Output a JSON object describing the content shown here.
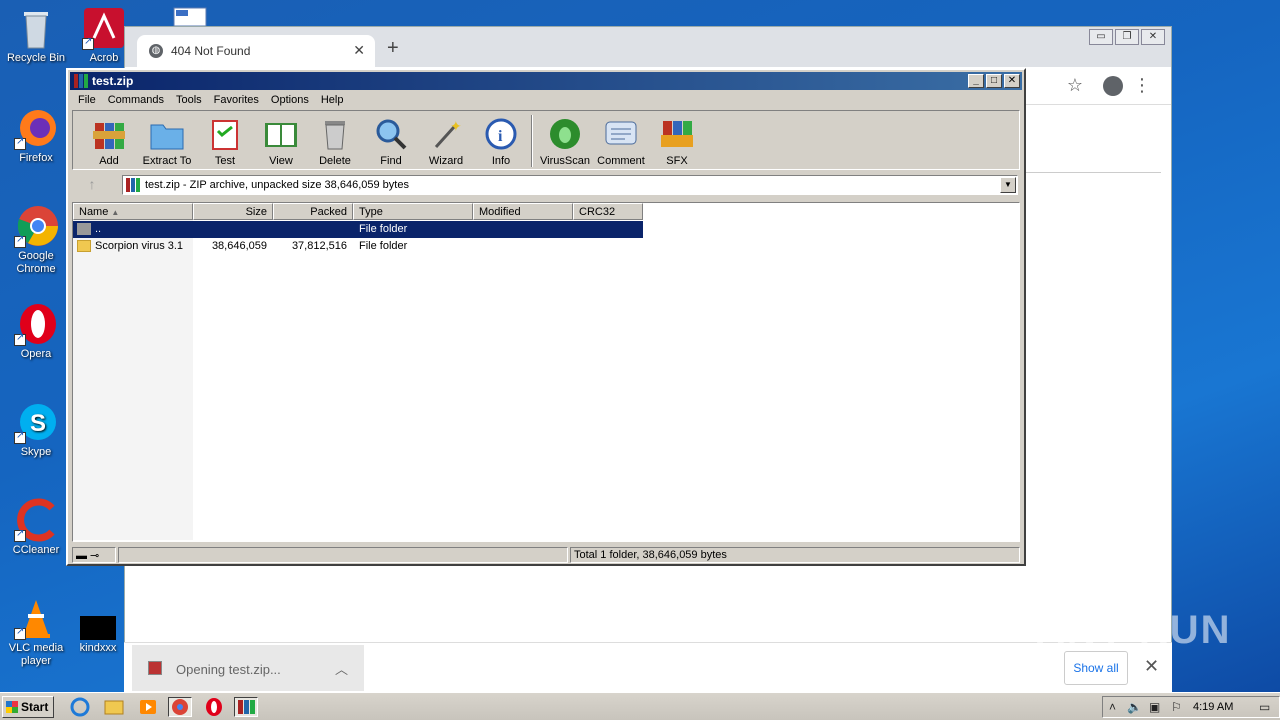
{
  "desktop": {
    "icons": [
      {
        "label": "Recycle Bin",
        "icon": "recycle-bin-icon"
      },
      {
        "label": "Acrob",
        "icon": "acrobat-icon"
      },
      {
        "label": "Firefox",
        "icon": "firefox-icon"
      },
      {
        "label": "Google Chrome",
        "icon": "chrome-icon"
      },
      {
        "label": "Opera",
        "icon": "opera-icon"
      },
      {
        "label": "Skype",
        "icon": "skype-icon"
      },
      {
        "label": "CCleaner",
        "icon": "ccleaner-icon"
      },
      {
        "label": "VLC media player",
        "icon": "vlc-icon"
      },
      {
        "label": "kindxxx",
        "icon": "file-icon"
      }
    ]
  },
  "browser": {
    "tab_title": "404 Not Found",
    "tab_close": "✕",
    "new_tab": "+",
    "download": {
      "filename": "Opening test.zip...",
      "show_all": "Show all",
      "close": "✕"
    }
  },
  "winrar": {
    "title": "test.zip",
    "menu": [
      "File",
      "Commands",
      "Tools",
      "Favorites",
      "Options",
      "Help"
    ],
    "toolbar": [
      {
        "label": "Add",
        "icon": "add-archive-icon"
      },
      {
        "label": "Extract To",
        "icon": "extract-folder-icon"
      },
      {
        "label": "Test",
        "icon": "test-clipboard-icon"
      },
      {
        "label": "View",
        "icon": "view-book-icon"
      },
      {
        "label": "Delete",
        "icon": "trash-icon"
      },
      {
        "label": "Find",
        "icon": "magnifier-icon"
      },
      {
        "label": "Wizard",
        "icon": "wand-icon"
      },
      {
        "label": "Info",
        "icon": "info-icon"
      },
      {
        "label": "VirusScan",
        "icon": "bug-scan-icon"
      },
      {
        "label": "Comment",
        "icon": "comment-icon"
      },
      {
        "label": "SFX",
        "icon": "sfx-icon"
      }
    ],
    "address": "test.zip - ZIP archive, unpacked size 38,646,059 bytes",
    "columns": [
      "Name",
      "Size",
      "Packed",
      "Type",
      "Modified",
      "CRC32"
    ],
    "rows": [
      {
        "name": "..",
        "size": "",
        "packed": "",
        "type": "File folder",
        "modified": "",
        "crc": "",
        "selected": true
      },
      {
        "name": "Scorpion virus 3.1",
        "size": "38,646,059",
        "packed": "37,812,516",
        "type": "File folder",
        "modified": "",
        "crc": "",
        "selected": false
      }
    ],
    "status": "Total 1 folder, 38,646,059 bytes"
  },
  "taskbar": {
    "start": "Start",
    "clock": "4:19 AM"
  },
  "watermark": "ANY RUN"
}
